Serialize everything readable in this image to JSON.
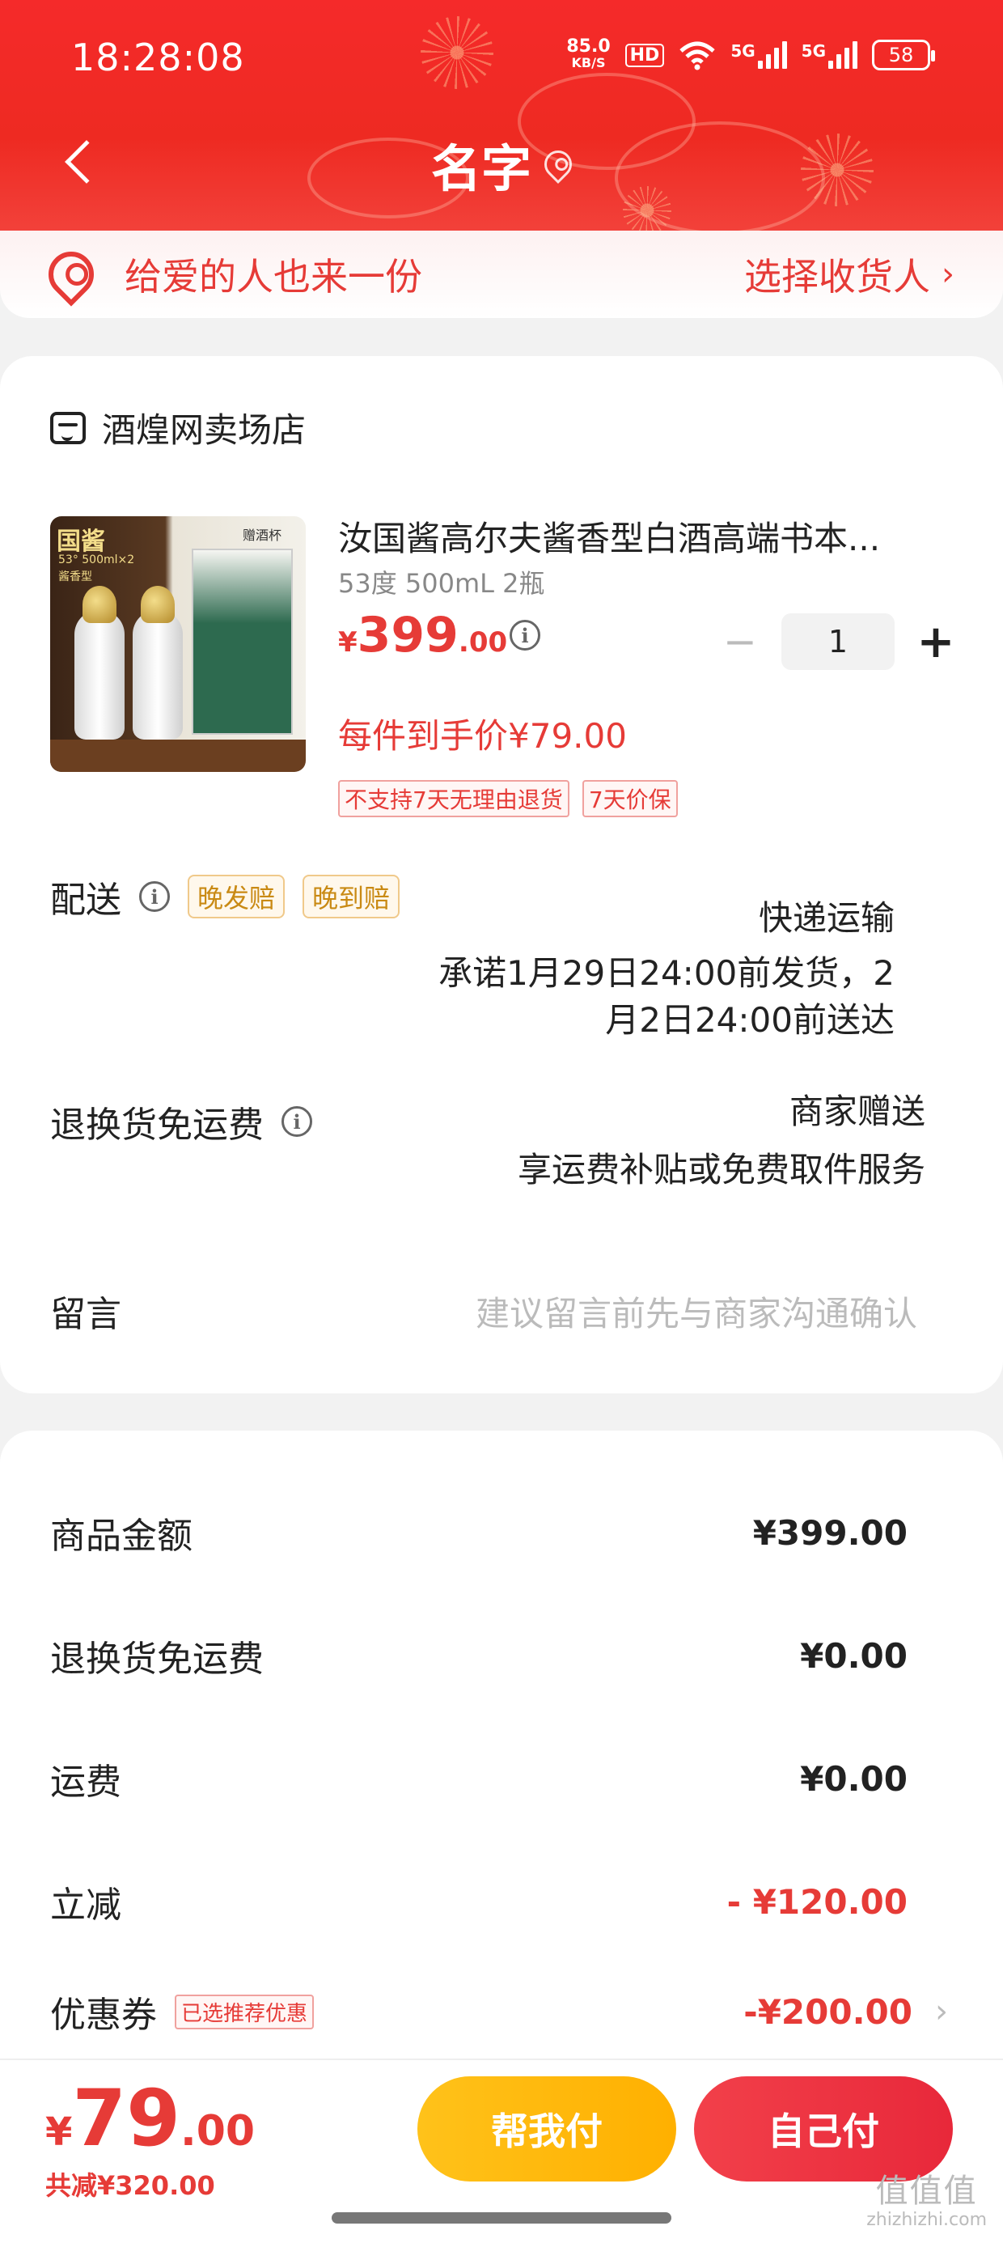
{
  "status_bar": {
    "time": "18:28:08",
    "net_speed_value": "85.0",
    "net_speed_unit": "KB/S",
    "hd_label": "HD",
    "signal1_label": "5G",
    "signal2_label": "5G",
    "battery": "58"
  },
  "nav": {
    "title": "名字"
  },
  "address": {
    "prompt": "给爱的人也来一份",
    "select_label": "选择收货人",
    "chevron": "›"
  },
  "store": {
    "name": "酒煌网卖场店"
  },
  "product": {
    "title": "汝国酱高尔夫酱香型白酒高端书本...",
    "spec": "53度 500mL 2瓶",
    "price_currency": "¥",
    "price_int": "399",
    "price_dec": ".00",
    "quantity": "1",
    "minus_label": "−",
    "plus_label": "+",
    "final_price_text": "每件到手价¥79.00",
    "tags": [
      "不支持7天无理由退货",
      "7天价保"
    ],
    "image": {
      "brand": "国酱",
      "sub1": "53° 500ml×2",
      "sub2": "酱香型",
      "gift": "赠酒杯"
    }
  },
  "delivery": {
    "label": "配送",
    "badges": [
      "晚发赔",
      "晚到赔"
    ],
    "method": "快递运输",
    "promise_line1": "承诺1月29日24:00前发货，2",
    "promise_line2": "月2日24:00前送达"
  },
  "return_service": {
    "label": "退换货免运费",
    "value_line1": "商家赠送",
    "value_line2": "享运费补贴或免费取件服务"
  },
  "message": {
    "label": "留言",
    "placeholder": "建议留言前先与商家沟通确认"
  },
  "summary": {
    "rows": [
      {
        "label": "商品金额",
        "value": "¥399.00"
      },
      {
        "label": "退换货免运费",
        "value": "¥0.00"
      },
      {
        "label": "运费",
        "value": "¥0.00"
      },
      {
        "label": "立减",
        "value": "- ¥120.00"
      }
    ],
    "coupon": {
      "label": "优惠券",
      "tag": "已选推荐优惠",
      "value": "-¥200.00",
      "chevron": "›"
    }
  },
  "bottom_bar": {
    "total_currency": "¥",
    "total_int": "79",
    "total_dec": ".00",
    "saved": "共减¥320.00",
    "help_pay_label": "帮我付",
    "self_pay_label": "自己付"
  },
  "watermark": {
    "logo": "值值值",
    "domain": "zhizhizhi.com"
  },
  "colors": {
    "primary_red": "#e63b37",
    "header_red": "#ee2a22",
    "help_btn_yellow": "#ffb000",
    "self_btn_red": "#e8283a"
  }
}
